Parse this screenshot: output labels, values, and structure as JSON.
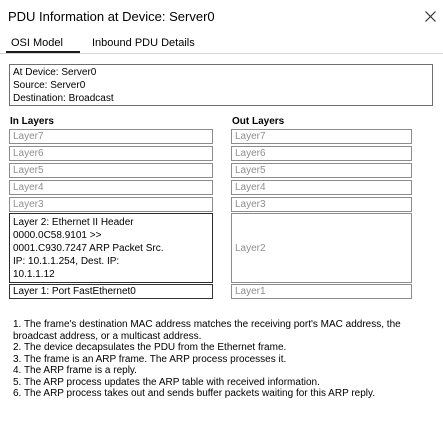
{
  "window": {
    "title": "PDU Information at Device: Server0",
    "close_icon": "close-icon"
  },
  "tabs": [
    {
      "label": "OSI Model",
      "active": true
    },
    {
      "label": "Inbound PDU Details",
      "active": false
    }
  ],
  "info": {
    "device": "At Device: Server0",
    "source": "Source: Server0",
    "destination": "Destination: Broadcast"
  },
  "in_layers": {
    "header": "In Layers",
    "layer7": "Layer7",
    "layer6": "Layer6",
    "layer5": "Layer5",
    "layer4": "Layer4",
    "layer3": "Layer3",
    "layer2_lines": [
      "Layer 2: Ethernet II Header",
      "0000.0C58.9101 >>",
      "0001.C930.7247 ARP Packet Src.",
      "IP: 10.1.1.254, Dest. IP:",
      "10.1.1.12"
    ],
    "layer1": "Layer 1: Port FastEthernet0"
  },
  "out_layers": {
    "header": "Out Layers",
    "layer7": "Layer7",
    "layer6": "Layer6",
    "layer5": "Layer5",
    "layer4": "Layer4",
    "layer3": "Layer3",
    "layer2": "Layer2",
    "layer1": "Layer1"
  },
  "description": [
    "1. The frame's destination MAC address matches the receiving port's MAC address, the broadcast address, or a multicast address.",
    "2. The device decapsulates the PDU from the Ethernet frame.",
    "3. The frame is an ARP frame. The ARP process processes it.",
    "4. The ARP frame is a reply.",
    "5. The ARP process updates the ARP table with received information.",
    "6. The ARP process takes out and sends buffer packets waiting for this ARP reply."
  ]
}
